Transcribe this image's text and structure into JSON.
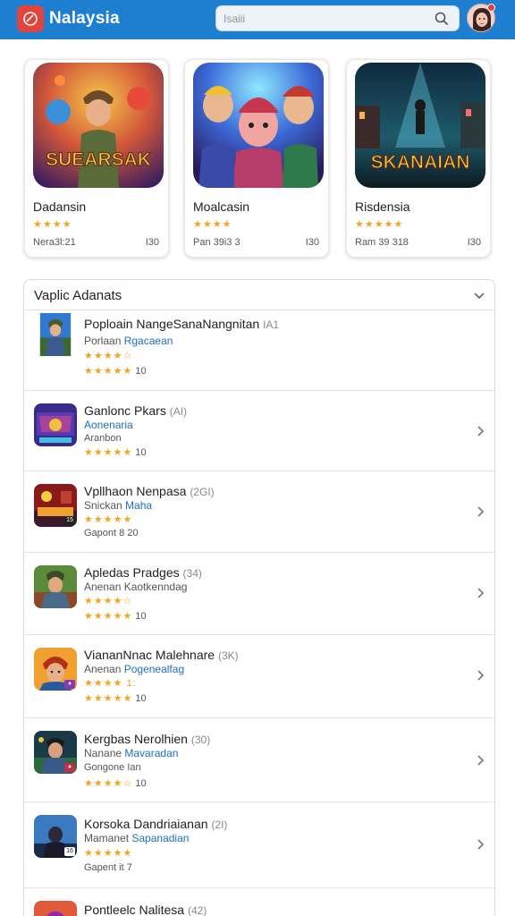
{
  "header": {
    "title": "Nalaysia",
    "search_placeholder": "Isaiii",
    "logo_icon": "app-logo-icon",
    "search_icon": "search-icon",
    "brand_color": "#1e7fd0"
  },
  "featured": [
    {
      "art_text": "SUEARSAK",
      "name": "Dadansin",
      "stars": "★★★★",
      "meta": "Nera3l:21",
      "count": "I30"
    },
    {
      "art_text": "",
      "name": "Moalcasin",
      "stars": "★★★★",
      "meta": "Pan 39i3 3",
      "count": "I30"
    },
    {
      "art_text": "SKANAIAN",
      "name": "Risdensia",
      "stars": "★★★★★",
      "meta": "Ram 39 318",
      "count": "I30"
    }
  ],
  "list": {
    "title": "Vaplic  Adanats",
    "rows": [
      {
        "title": "Poploain  NangeSanaNangnitan",
        "suffix": "IA1",
        "sub_a": "Porlaan",
        "sub_b": "Rgacaean",
        "stars": "★★★★☆",
        "line_stars": "★★★★★",
        "line_text": "10",
        "chevron": false
      },
      {
        "title": "Ganlonc  Pkars",
        "suffix": "(AI)",
        "sub_a": "",
        "sub_b": "Aonenaria",
        "extra": "Aranbon",
        "line_stars": "★★★★★",
        "line_text": "10",
        "chevron": true
      },
      {
        "title": "Vpllhaon  Nenpasa",
        "suffix": "(2GI)",
        "sub_a": "Snickan",
        "sub_b": "Maha",
        "stars": "★★★★★",
        "line_stars": "",
        "line_text": "Gapont  8  20",
        "chevron": true
      },
      {
        "title": "Apledas  Pradges",
        "suffix": "(34)",
        "sub_a": "Anenan  Kaotkenndag",
        "sub_b": "",
        "stars": "★★★★☆",
        "line_stars": "★★★★★",
        "line_text": "10",
        "chevron": true
      },
      {
        "title": "ViananNnac Malehnare",
        "suffix": "(3K)",
        "sub_a": "Anenan",
        "sub_b": "Pogenealfag",
        "stars": "★★★★ 1:",
        "line_stars": "★★★★★",
        "line_text": "10",
        "chevron": true
      },
      {
        "title": "Kergbas  Nerolhien",
        "suffix": "(30)",
        "sub_a": "Nanane",
        "sub_b": "Mavaradan",
        "extra": "Gongone  Ian",
        "line_stars": "★★★★☆",
        "line_text": "10",
        "chevron": true
      },
      {
        "title": "Korsoka  Dandriaianan",
        "suffix": "(2I)",
        "sub_a": "Mamanet",
        "sub_b": "Sapanadian",
        "stars": "★★★★★",
        "line_stars": "",
        "line_text": "Gapent  it  7",
        "chevron": true
      },
      {
        "title": "Pontleelc  Nalitesa",
        "suffix": "(42)",
        "sub_a": "",
        "sub_b": "",
        "line_stars": "",
        "line_text": "",
        "chevron": false
      }
    ]
  }
}
